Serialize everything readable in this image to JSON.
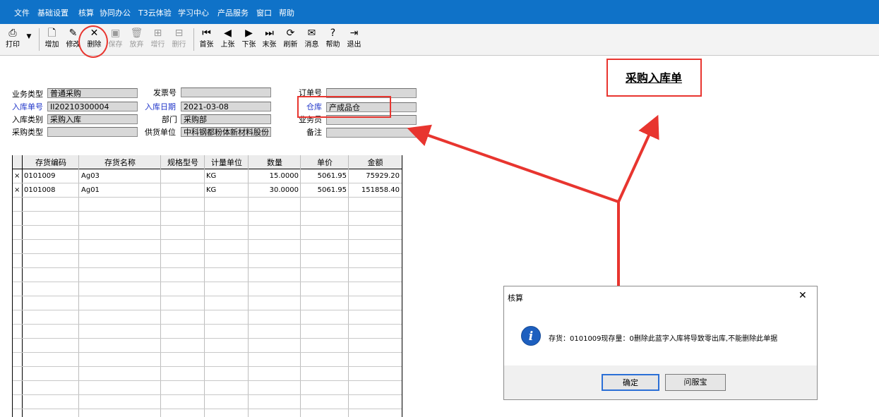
{
  "menu": [
    "文件",
    "基础设置",
    "核算",
    "协同办公",
    "T3云体验",
    "学习中心",
    "产品服务",
    "窗口",
    "帮助"
  ],
  "toolbar": {
    "print": "打印",
    "add": "增加",
    "modify": "修改",
    "delete": "删除",
    "save": "保存",
    "discard": "放弃",
    "add_row": "增行",
    "delete_row": "删行",
    "first": "首张",
    "prev": "上张",
    "next": "下张",
    "last": "末张",
    "refresh": "刷新",
    "message": "消息",
    "help": "帮助",
    "exit": "退出"
  },
  "form": {
    "title": "采购入库单",
    "business_type_label": "业务类型",
    "business_type_value": "普通采购",
    "receipt_no_label": "入库单号",
    "receipt_no_value": "II20210300004",
    "receipt_category_label": "入库类别",
    "receipt_category_value": "采购入库",
    "purchase_type_label": "采购类型",
    "purchase_type_value": "",
    "invoice_no_label": "发票号",
    "invoice_no_value": "",
    "receipt_date_label": "入库日期",
    "receipt_date_value": "2021-03-08",
    "department_label": "部门",
    "department_value": "采购部",
    "supplier_label": "供货单位",
    "supplier_value": "中科钢都粉体新材料股份",
    "order_no_label": "订单号",
    "order_no_value": "",
    "warehouse_label": "仓库",
    "warehouse_value": "产成品仓",
    "salesperson_label": "业务员",
    "salesperson_value": "",
    "remarks_label": "备注",
    "remarks_value": ""
  },
  "grid": {
    "headers": [
      "存货编码",
      "存货名称",
      "规格型号",
      "计量单位",
      "数量",
      "单价",
      "金额"
    ],
    "rows": [
      {
        "mark": "×",
        "code": "0101009",
        "name": "Ag03",
        "spec": "",
        "unit": "KG",
        "qty": "15.0000",
        "price": "5061.95",
        "amount": "75929.20"
      },
      {
        "mark": "×",
        "code": "0101008",
        "name": "Ag01",
        "spec": "",
        "unit": "KG",
        "qty": "30.0000",
        "price": "5061.95",
        "amount": "151858.40"
      }
    ]
  },
  "dialog": {
    "title": "核算",
    "message": "存货：0101009现存量：0删除此蓝字入库将导致零出库,不能删除此单据",
    "ok_label": "确定",
    "help_label": "问服宝",
    "close_glyph": "✕",
    "info_glyph": "i"
  },
  "colors": {
    "menubar": "#0f72c8",
    "callout": "#e8352f",
    "label_blue": "#1f34c9",
    "field_bg": "#d8d8d8",
    "info_blue": "#1d5fbf"
  }
}
